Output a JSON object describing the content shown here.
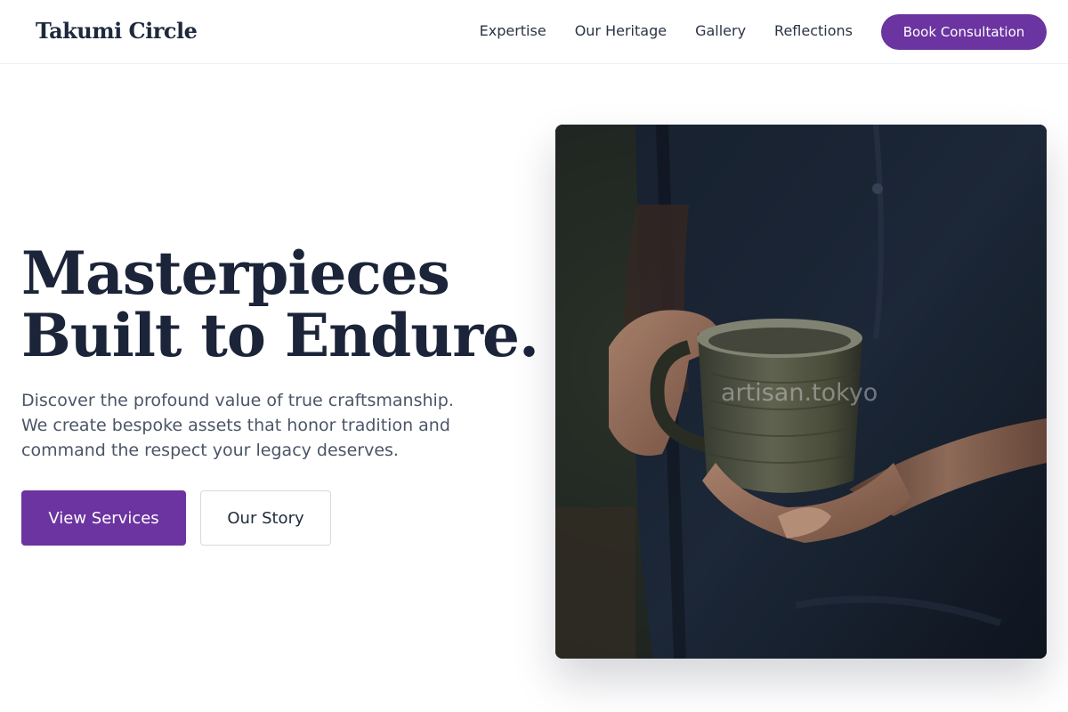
{
  "brand": {
    "name": "Takumi Circle"
  },
  "nav": {
    "links": [
      "Expertise",
      "Our Heritage",
      "Gallery",
      "Reflections"
    ],
    "cta_label": "Book Consultation"
  },
  "hero": {
    "headline_lines": [
      "Masterpieces",
      "Built to Endure."
    ],
    "description_lines": [
      "Discover the profound value of true craftsmanship.",
      "We create bespoke assets that honor tradition and",
      "command the respect your legacy deserves."
    ],
    "primary_button": "View Services",
    "secondary_button": "Our Story",
    "image_watermark": "artisan.tokyo"
  },
  "colors": {
    "accent": "#6b34a0",
    "heading": "#1b2438",
    "body_text": "#4b5567",
    "background": "#ffffff"
  }
}
